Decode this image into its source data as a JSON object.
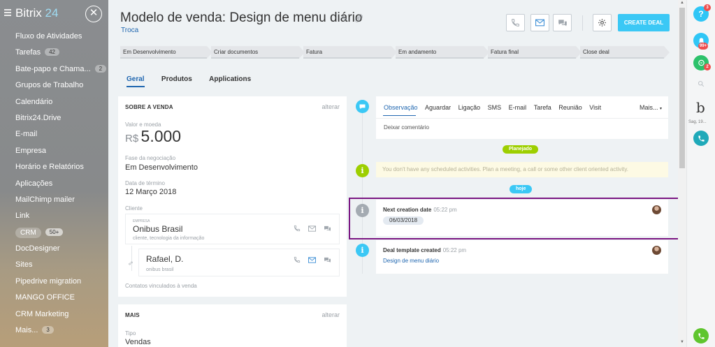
{
  "sidebar": {
    "logo_text": "Bitrix",
    "logo_num": "24",
    "close_glyph": "✕",
    "items": [
      {
        "label": "Fluxo de Atividades"
      },
      {
        "label": "Tarefas",
        "badge": "42"
      },
      {
        "label": "Bate-papo e Chama...",
        "badge": "2"
      },
      {
        "label": "Grupos de Trabalho"
      },
      {
        "label": "Calendário"
      },
      {
        "label": "Bitrix24.Drive"
      },
      {
        "label": "E-mail"
      },
      {
        "label": "Empresa"
      },
      {
        "label": "Horário e Relatórios"
      },
      {
        "label": "Aplicações"
      },
      {
        "label": "MailChimp mailer"
      },
      {
        "label": "Link"
      },
      {
        "label": "CRM",
        "badge": "50+"
      },
      {
        "label": "DocDesigner"
      },
      {
        "label": "Sites"
      },
      {
        "label": "Pipedrive migration"
      },
      {
        "label": "MANGO OFFICE"
      },
      {
        "label": "CRM Marketing"
      },
      {
        "label": "Mais...",
        "badge": "3"
      }
    ]
  },
  "header": {
    "title": "Modelo de venda: Design de menu diário",
    "subtitle": "Troca",
    "create_label": "CREATE DEAL"
  },
  "stages": [
    {
      "label": "Em Desenvolvimento"
    },
    {
      "label": "Criar documentos"
    },
    {
      "label": "Fatura"
    },
    {
      "label": "Em andamento"
    },
    {
      "label": "Fatura final"
    },
    {
      "label": "Close deal"
    }
  ],
  "tabs": [
    {
      "label": "Geral"
    },
    {
      "label": "Produtos"
    },
    {
      "label": "Applications"
    }
  ],
  "about": {
    "title": "SOBRE A VENDA",
    "edit": "alterar",
    "amount_label": "Valor e moeda",
    "currency": "R$",
    "amount": "5.000",
    "stage_label": "Fase da negociação",
    "stage_value": "Em Desenvolvimento",
    "end_label": "Data de término",
    "end_value": "12 Março 2018",
    "client_label": "Cliente",
    "company_tag": "EMPRESA",
    "company_name": "Onibus Brasil",
    "company_sub": "cliente, tecnologia da informação",
    "contact_name": "Rafael, D.",
    "contact_sub": "onibus brasil",
    "linked_label": "Contatos vinculados à venda"
  },
  "more": {
    "title": "MAIS",
    "edit": "alterar",
    "type_label": "Tipo",
    "type_value": "Vendas"
  },
  "activity": {
    "tabs": [
      {
        "label": "Observação"
      },
      {
        "label": "Aguardar"
      },
      {
        "label": "Ligação"
      },
      {
        "label": "SMS"
      },
      {
        "label": "E-mail"
      },
      {
        "label": "Tarefa"
      },
      {
        "label": "Reunião"
      },
      {
        "label": "Visit"
      }
    ],
    "more": "Mais...",
    "comment_placeholder": "Deixar comentário"
  },
  "timeline": {
    "planned_label": "Planejado",
    "planned_notice": "You don't have any scheduled activities. Plan a meeting, a call or some other client oriented activity.",
    "today_label": "hoje",
    "events": [
      {
        "title": "Next creation date",
        "time": "05:22 pm",
        "chip": "06/03/2018"
      },
      {
        "title": "Deal template created",
        "time": "05:22 pm",
        "link": "Design de menu diário"
      }
    ]
  },
  "right_panel": {
    "help_badge": "3",
    "notif_badge": "99+",
    "chat_badge": "2",
    "user_initial": "b",
    "user_name": "Sag, 19..."
  },
  "colors": {
    "accent": "#3bc8f5",
    "link": "#2067b0",
    "planned_green": "#9dcf00",
    "highlight": "#7a1682"
  }
}
